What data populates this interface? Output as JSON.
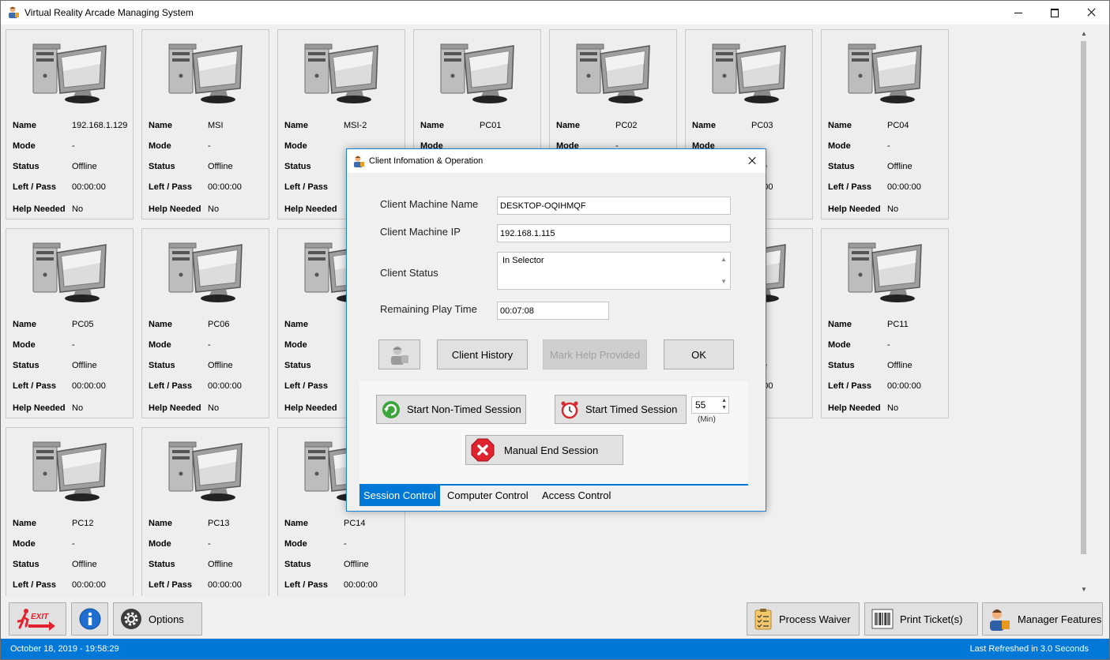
{
  "window": {
    "title": "Virtual Reality Arcade Managing System"
  },
  "cards": {
    "labels": {
      "name": "Name",
      "mode": "Mode",
      "status": "Status",
      "left": "Left / Pass",
      "help": "Help Needed"
    },
    "items": [
      {
        "name": "192.168.1.129",
        "mode": "-",
        "status": "Offline",
        "left": "00:00:00",
        "help": "No"
      },
      {
        "name": "MSI",
        "mode": "-",
        "status": "Offline",
        "left": "00:00:00",
        "help": "No"
      },
      {
        "name": "MSI-2",
        "mode": "",
        "status": "",
        "left": "",
        "help": ""
      },
      {
        "name": "PC01",
        "mode": "",
        "status": "",
        "left": "",
        "help": ""
      },
      {
        "name": "PC02",
        "mode": "-",
        "status": "",
        "left": "",
        "help": ""
      },
      {
        "name": "PC03",
        "mode": "",
        "status": "fline",
        "left": "00:00",
        "help": ""
      },
      {
        "name": "PC04",
        "mode": "-",
        "status": "Offline",
        "left": "00:00:00",
        "help": "No"
      },
      {
        "name": "PC05",
        "mode": "-",
        "status": "Offline",
        "left": "00:00:00",
        "help": "No"
      },
      {
        "name": "PC06",
        "mode": "-",
        "status": "Offline",
        "left": "00:00:00",
        "help": "No"
      },
      {
        "name": "",
        "mode": "",
        "status": "",
        "left": "",
        "help": ""
      },
      {
        "name": "",
        "mode": "",
        "status": "",
        "left": "",
        "help": ""
      },
      {
        "name": "",
        "mode": "",
        "status": "",
        "left": "",
        "help": ""
      },
      {
        "name": "10",
        "mode": "",
        "status": "fline",
        "left": "00:00",
        "help": ""
      },
      {
        "name": "PC11",
        "mode": "-",
        "status": "Offline",
        "left": "00:00:00",
        "help": "No"
      },
      {
        "name": "PC12",
        "mode": "-",
        "status": "Offline",
        "left": "00:00:00",
        "help": ""
      },
      {
        "name": "PC13",
        "mode": "-",
        "status": "Offline",
        "left": "00:00:00",
        "help": ""
      },
      {
        "name": "PC14",
        "mode": "-",
        "status": "Offline",
        "left": "00:00:00",
        "help": ""
      }
    ]
  },
  "toolbar": {
    "exit_label": "EXIT",
    "options_label": "Options",
    "process_waiver_label": "Process Waiver",
    "print_tickets_label": "Print Ticket(s)",
    "manager_features_label": "Manager Features"
  },
  "statusbar": {
    "datetime": "October 18, 2019 - 19:58:29",
    "refresh": "Last Refreshed in 3.0 Seconds"
  },
  "dialog": {
    "title": "Client Infomation & Operation",
    "machine_name_label": "Client Machine Name",
    "machine_name_value": "DESKTOP-OQIHMQF",
    "machine_ip_label": "Client Machine IP",
    "machine_ip_value": "192.168.1.115",
    "status_label": "Client Status",
    "status_value": "In Selector",
    "remaining_label": "Remaining Play Time",
    "remaining_value": "00:07:08",
    "history_label": "Client History",
    "mark_help_label": "Mark Help Provided",
    "ok_label": "OK",
    "non_timed_label": "Start Non-Timed Session",
    "timed_label": "Start Timed Session",
    "minutes_value": "55",
    "minutes_unit": "(Min)",
    "manual_end_label": "Manual End Session",
    "tabs": [
      "Session Control",
      "Computer Control",
      "Access Control"
    ]
  },
  "colors": {
    "accent": "#0078d7",
    "danger": "#e0242f"
  }
}
